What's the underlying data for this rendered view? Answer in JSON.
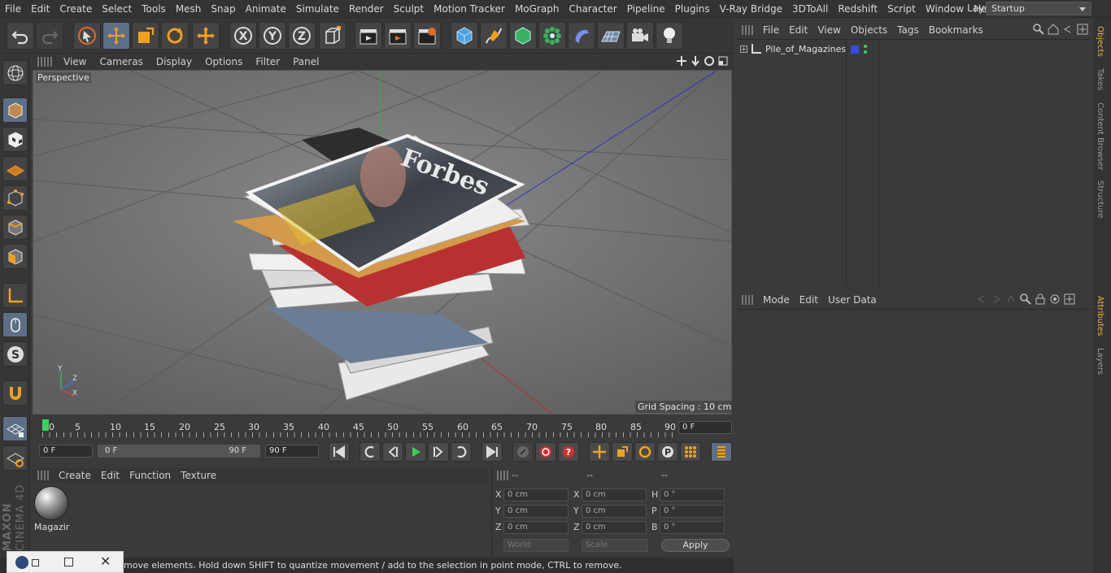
{
  "menu": [
    "File",
    "Edit",
    "Create",
    "Select",
    "Tools",
    "Mesh",
    "Snap",
    "Animate",
    "Simulate",
    "Render",
    "Sculpt",
    "Motion Tracker",
    "MoGraph",
    "Character",
    "Pipeline",
    "Plugins",
    "V-Ray Bridge",
    "3DToAll",
    "Redshift",
    "Script",
    "Window",
    "Help"
  ],
  "layout": {
    "label": "Layout:",
    "value": "Startup"
  },
  "viewport": {
    "menu": [
      "View",
      "Cameras",
      "Display",
      "Options",
      "Filter",
      "Panel"
    ],
    "label": "Perspective",
    "grid_spacing": "Grid Spacing : 10 cm",
    "axes": {
      "y": "Y",
      "z": "Z",
      "x": "X"
    }
  },
  "timeline": {
    "ticks": [
      "0",
      "5",
      "10",
      "15",
      "20",
      "25",
      "30",
      "35",
      "40",
      "45",
      "50",
      "55",
      "60",
      "65",
      "70",
      "75",
      "80",
      "85",
      "90"
    ],
    "current_frame": "0 F",
    "start": "0 F",
    "range_start": "0 F",
    "range_end": "90 F",
    "end": "90 F"
  },
  "material_manager": {
    "menu": [
      "Create",
      "Edit",
      "Function",
      "Texture"
    ],
    "material_name": "Magazir"
  },
  "coordinates": {
    "headers": [
      "--",
      "--",
      "--"
    ],
    "rows": [
      {
        "l1": "X",
        "v1": "0 cm",
        "l2": "X",
        "v2": "0 cm",
        "l3": "H",
        "v3": "0 °"
      },
      {
        "l1": "Y",
        "v1": "0 cm",
        "l2": "Y",
        "v2": "0 cm",
        "l3": "P",
        "v3": "0 °"
      },
      {
        "l1": "Z",
        "v1": "0 cm",
        "l2": "Z",
        "v2": "0 cm",
        "l3": "B",
        "v3": "0 °"
      }
    ],
    "space": "World",
    "mode": "Scale",
    "apply": "Apply"
  },
  "object_manager": {
    "menu": [
      "File",
      "Edit",
      "View",
      "Objects",
      "Tags",
      "Bookmarks"
    ],
    "object_name": "Pile_of_Magazines"
  },
  "attributes": {
    "menu": [
      "Mode",
      "Edit",
      "User Data"
    ]
  },
  "side_tabs": [
    "Objects",
    "Takes",
    "Content Browser",
    "Structure",
    "Attributes",
    "Layers"
  ],
  "status": "move elements. Hold down SHIFT to quantize movement / add to the selection in point mode, CTRL to remove.",
  "brand": {
    "line1": "MAXON",
    "line2": "CINEMA 4D"
  },
  "colors": {
    "accent": "#f0b340",
    "selected": "#5d6f86",
    "bg": "#3a3a3a"
  }
}
